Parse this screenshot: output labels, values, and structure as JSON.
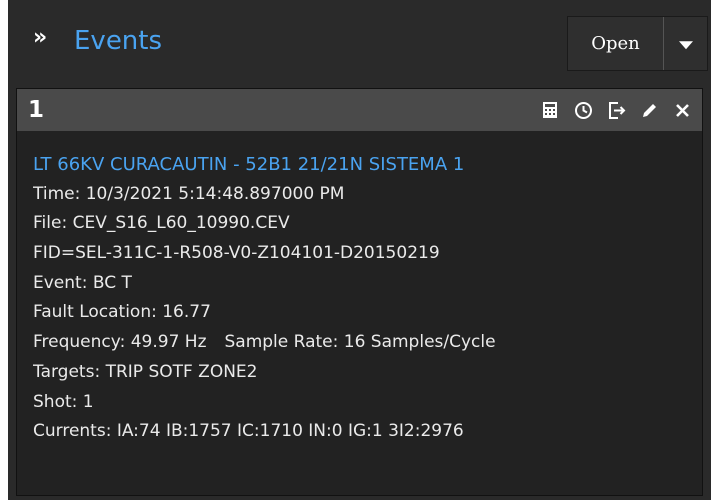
{
  "header": {
    "title": "Events",
    "chevron_glyph": "»",
    "open_button": "Open",
    "accent_color": "#4aa3f0",
    "caret_icon": "chevron-down-icon"
  },
  "event_card": {
    "number": "1",
    "toolbar_icons": [
      "calculator-icon",
      "clock-icon",
      "export-icon",
      "pencil-icon",
      "close-icon"
    ],
    "name": "LT 66KV CURACAUTIN - 52B1 21/21N SISTEMA 1",
    "time": "Time:  10/3/2021 5:14:48.897000 PM",
    "file": "File: CEV_S16_L60_10990.CEV",
    "fid": "FID=SEL-311C-1-R508-V0-Z104101-D20150219",
    "event": "Event: BC T",
    "fault_location": "Fault Location: 16.77",
    "frequency": "Frequency: 49.97 Hz",
    "sample_rate": "Sample Rate: 16 Samples/Cycle",
    "targets": "Targets: TRIP SOTF ZONE2",
    "shot": "Shot: 1",
    "currents": "Currents: IA:74 IB:1757 IC:1710 IN:0 IG:1 3I2:2976"
  }
}
